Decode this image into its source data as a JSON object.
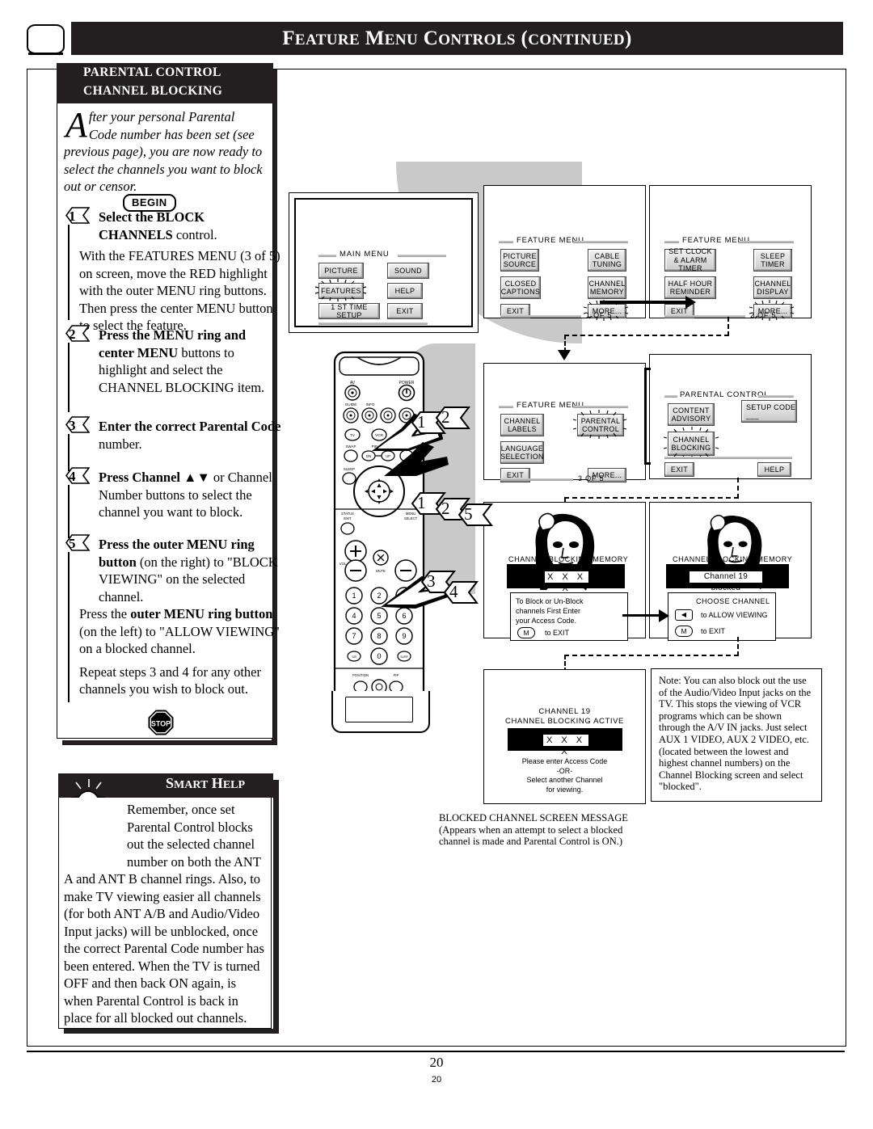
{
  "header": {
    "title_main": "FEATURE MENU CONTROLS (CONTINUED)",
    "title_parts": [
      "F",
      "EATURE",
      " M",
      "ENU",
      " C",
      "ONTROLS",
      " (",
      "CONTINUED",
      ")"
    ],
    "tv_icon": "tv-icon"
  },
  "sidebar": {
    "head_line1": "PARENTAL CONTROL",
    "head_line2": "CHANNEL BLOCKING",
    "intro_dropcap": "A",
    "intro_text": "fter your personal Parental Code number has been set (see previous page), you are now ready to select the channels you want to block out or censor.",
    "begin_label": "BEGIN",
    "steps": [
      {
        "num": "1",
        "bold_lead": "Select the BLOCK CHANNELS",
        "lead_tail": " control.",
        "body": "With the FEATURES MENU (3 of 5) on screen, move the RED highlight with the outer MENU ring buttons. Then press the center MENU button to select the feature."
      },
      {
        "num": "2",
        "bold_lead": "Press the MENU ring and center MENU",
        "lead_tail": " buttons to highlight and select the CHANNEL BLOCKING item.",
        "body": ""
      },
      {
        "num": "3",
        "bold_lead": "Enter the correct Parental Code",
        "lead_tail": " number.",
        "body": ""
      },
      {
        "num": "4",
        "bold_lead": "Press Channel ▲▼",
        "lead_tail": " or Channel Number buttons to select the channel you want to block.",
        "body": ""
      },
      {
        "num": "5",
        "bold_lead": "Press the outer MENU ring button",
        "lead_tail": " (on the right) to \"BLOCK VIEWING\" on the selected channel.",
        "body2_pre": "Press the ",
        "body2_bold": "outer MENU ring button",
        "body2_post": " (on the left) to \"ALLOW VIEWING\" on a blocked channel.",
        "body3": "Repeat steps 3 and 4 for any other channels you wish to block out."
      }
    ],
    "stop_label": "STOP"
  },
  "smart_help": {
    "title": "SMART HELP",
    "title_parts": [
      "S",
      "MART",
      " H",
      "ELP"
    ],
    "body": "Remember, once set Parental Control blocks out the selected channel number on both the ANT A and ANT B channel rings. Also, to make TV viewing easier all channels (for both ANT A/B and Audio/Video Input jacks) will be unblocked, once the correct Parental Code number has been entered. When the TV is turned OFF and then back ON again, is when Parental Control is back in place for all blocked out channels."
  },
  "diagrams": {
    "main_menu": {
      "title": "MAIN MENU",
      "buttons_left": [
        "PICTURE",
        "FEATURES",
        "1 ST TIME SETUP"
      ],
      "buttons_right": [
        "SOUND",
        "HELP",
        "EXIT"
      ],
      "highlighted": "FEATURES"
    },
    "feature_menu_1": {
      "title": "FEATURE MENU",
      "buttons_left": [
        "PICTURE SOURCE",
        "CLOSED CAPTIONS",
        "EXIT"
      ],
      "buttons_right": [
        "CABLE TUNING",
        "CHANNEL MEMORY",
        "MORE..."
      ],
      "page_of": "1 OF 5",
      "highlighted": "MORE..."
    },
    "feature_menu_2": {
      "title": "FEATURE MENU",
      "buttons_left": [
        "SET CLOCK & ALARM TIMER",
        "HALF HOUR REMINDER",
        "EXIT"
      ],
      "buttons_right": [
        "SLEEP TIMER",
        "CHANNEL DISPLAY",
        "MORE..."
      ],
      "page_of": "2 OF 5",
      "highlighted": "MORE..."
    },
    "feature_menu_3": {
      "title": "FEATURE MENU",
      "buttons_left": [
        "CHANNEL LABELS",
        "LANGUAGE SELECTION",
        "EXIT"
      ],
      "buttons_right": [
        "PARENTAL CONTROL",
        "MORE..."
      ],
      "page_of": "3 OF 5",
      "highlighted": "PARENTAL CONTROL"
    },
    "parental_control": {
      "title": "PARENTAL CONTROL",
      "buttons_left": [
        "CONTENT ADVISORY",
        "CHANNEL BLOCKING",
        "EXIT"
      ],
      "buttons_right": [
        "SETUP CODE ___",
        "HELP"
      ],
      "highlighted": "CHANNEL BLOCKING"
    },
    "blocking_screen_1": {
      "title": "CHANNEL BLOCKING MEMORY",
      "code_value": "X X X X",
      "instruction_lines": [
        "To Block or Un-Block",
        "channels First Enter",
        "your Access Code."
      ],
      "key_icon": "M",
      "key_action": "to EXIT"
    },
    "blocking_screen_2": {
      "title": "CHANNEL BLOCKING MEMORY",
      "status_value": "Channel 19 blocked",
      "panel_title": "CHOOSE CHANNEL",
      "rows": [
        {
          "icon": "◀",
          "label": "to ALLOW VIEWING"
        },
        {
          "icon": "M",
          "label": "to EXIT"
        }
      ]
    },
    "blocked_message_screen": {
      "line1": "CHANNEL 19",
      "line2": "CHANNEL BLOCKING ACTIVE",
      "code_value": "X X X X",
      "foot1": "Please enter Access Code",
      "foot2": "-OR-",
      "foot3": "Select another Channel",
      "foot4": "for viewing."
    },
    "note_box": {
      "text": "Note: You can also block out  the use of the Audio/Video Input jacks on the TV. This stops the viewing of VCR programs which can be shown through the A/V IN jacks. Just select AUX 1 VIDEO, AUX 2 VIDEO, etc. (located between the lowest and highest channel numbers) on the Channel Blocking screen and select \"blocked\"."
    },
    "caption": {
      "line1": "BLOCKED CHANNEL SCREEN MESSAGE",
      "line2": "(Appears when an attempt to select a blocked",
      "line3": "channel is made and Parental Control is ON.)"
    },
    "callouts": [
      "1",
      "2",
      "1",
      "2",
      "5",
      "3",
      "4"
    ]
  },
  "remote": {
    "labels": [
      "AV",
      "POWER",
      "GUIDE",
      "INFO",
      "TV",
      "VCR",
      "ACC",
      "SWAP",
      "PIP CH",
      "SOURCE FRONT",
      "SLEEP",
      "STATUS EXIT",
      "MENU SELECT",
      "VOL",
      "MUTE",
      "POSITION",
      "PIP"
    ],
    "keypad": [
      "1",
      "2",
      "3",
      "4",
      "5",
      "6",
      "7",
      "8",
      "9",
      "0"
    ]
  },
  "footer": {
    "page_number": "20",
    "page_number_small": "20"
  },
  "colors": {
    "bar_black": "#231f20",
    "grey_swoosh": "#c9c9c9",
    "button_face": "#e0e0e0"
  }
}
